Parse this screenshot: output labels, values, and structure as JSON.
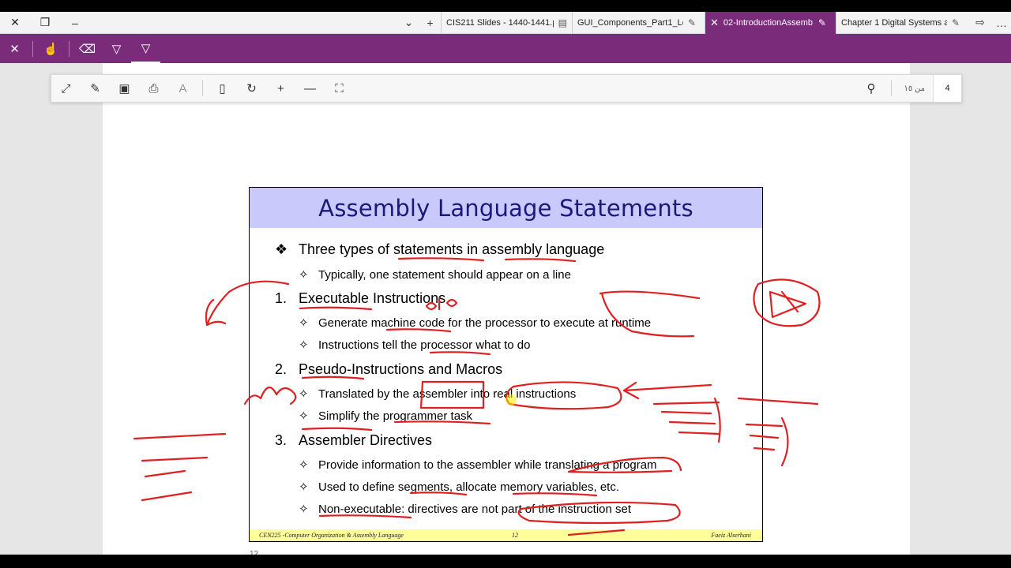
{
  "tabs": [
    {
      "title": "CIS211 Slides - 1440-1441.p",
      "icon": "pdf-icon",
      "active": false
    },
    {
      "title": "GUI_Components_Part1_Lec",
      "icon": "pen-icon",
      "active": false
    },
    {
      "title": "02-IntroductionAssemb",
      "icon": "pen-icon",
      "active": true
    },
    {
      "title": "Chapter 1 Digital Systems ar",
      "icon": "pen-icon",
      "active": false
    }
  ],
  "toolbar": {
    "page_of": "من ١٥",
    "page_number": "4"
  },
  "slide": {
    "title": "Assembly Language Statements",
    "items": [
      {
        "marker": "❖",
        "text": "Three types of statements in assembly language"
      },
      {
        "marker": "✧",
        "text": "Typically, one statement should appear on a line"
      },
      {
        "marker": "1.",
        "text": "Executable Instructions"
      },
      {
        "marker": "✧",
        "text": "Generate machine code for the processor to execute at runtime"
      },
      {
        "marker": "✧",
        "text": "Instructions tell the processor what to do"
      },
      {
        "marker": "2.",
        "text": "Pseudo-Instructions and Macros"
      },
      {
        "marker": "✧",
        "text": "Translated by the assembler into real instructions"
      },
      {
        "marker": "✧",
        "text": "Simplify the programmer task"
      },
      {
        "marker": "3.",
        "text": "Assembler Directives"
      },
      {
        "marker": "✧",
        "text": "Provide information to the assembler while translating a program"
      },
      {
        "marker": "✧",
        "text": "Used to define segments, allocate memory variables, etc."
      },
      {
        "marker": "✧",
        "text": "Non-executable: directives are not part of the instruction set"
      }
    ],
    "footer_left": "CEN225 -Computer Organization & Assembly Language",
    "footer_center": "12",
    "footer_right": "Faeiz Alserhani"
  },
  "bottom_label": "12",
  "ink_color": "#e02020"
}
